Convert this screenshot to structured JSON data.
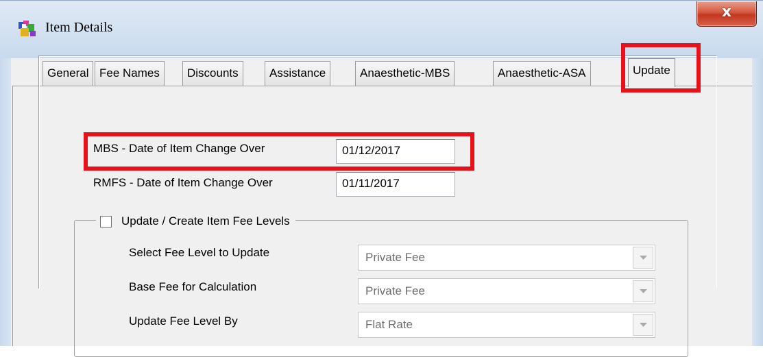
{
  "window": {
    "title": "Item Details",
    "close_symbol": "x",
    "icon": "app-icon"
  },
  "tabs": [
    {
      "label": "General",
      "active": false
    },
    {
      "label": "Fee Names",
      "active": false
    },
    {
      "label": "Discounts",
      "active": false
    },
    {
      "label": "Assistance",
      "active": false
    },
    {
      "label": "Anaesthetic-MBS",
      "active": false
    },
    {
      "label": "Anaesthetic-ASA",
      "active": false
    },
    {
      "label": "Update",
      "active": true
    }
  ],
  "update": {
    "mbs_label": "MBS - Date of Item Change Over",
    "mbs_value": "01/12/2017",
    "rmfs_label": "RMFS - Date of Item Change Over",
    "rmfs_value": "01/11/2017",
    "fee_levels_group": {
      "checkbox_label": "Update / Create Item Fee Levels",
      "checked": false,
      "select_fee_level_label": "Select Fee Level to Update",
      "select_fee_level_value": "Private Fee",
      "base_fee_label": "Base Fee for Calculation",
      "base_fee_value": "Private Fee",
      "update_by_label": "Update Fee Level By",
      "update_by_value": "Flat Rate"
    }
  },
  "colors": {
    "highlight": "#e8111a",
    "close_button": "#c2381f"
  }
}
